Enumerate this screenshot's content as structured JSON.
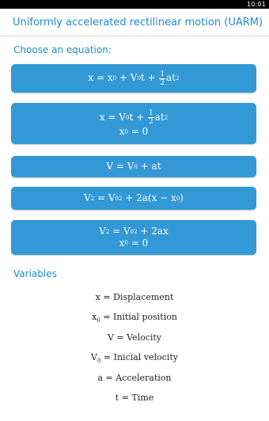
{
  "status_bar": {
    "time": "10:01"
  },
  "header": {
    "title": "Uniformly accelerated rectilinear motion (UARM)"
  },
  "equations_section": {
    "label": "Choose an equation:",
    "buttons": [
      {
        "id": "eq1",
        "lines": [
          "x = x0 + V0t + 1/2 at^2"
        ]
      },
      {
        "id": "eq2",
        "lines": [
          "x = V0t + 1/2 at^2",
          "x0 = 0"
        ]
      },
      {
        "id": "eq3",
        "lines": [
          "V = V0 + at"
        ]
      },
      {
        "id": "eq4",
        "lines": [
          "V^2 = V0^2 + 2a(x − x0)"
        ]
      },
      {
        "id": "eq5",
        "lines": [
          "V^2 = V0^2 + 2ax",
          "x0 = 0"
        ]
      }
    ]
  },
  "variables_section": {
    "label": "Variables",
    "items": [
      {
        "symbol": "x",
        "description": "Displacement"
      },
      {
        "symbol": "x",
        "symbol_sub": "0",
        "description": "Initial position"
      },
      {
        "symbol": "V",
        "description": "Velocity"
      },
      {
        "symbol": "V",
        "symbol_sub": "0",
        "description": "Inicial velocity"
      },
      {
        "symbol": "a",
        "description": "Acceleration"
      },
      {
        "symbol": "t",
        "description": "Time"
      }
    ]
  },
  "colors": {
    "accent": "#1e8bd1",
    "button": "#3399d6",
    "status_bar": "#000000"
  }
}
